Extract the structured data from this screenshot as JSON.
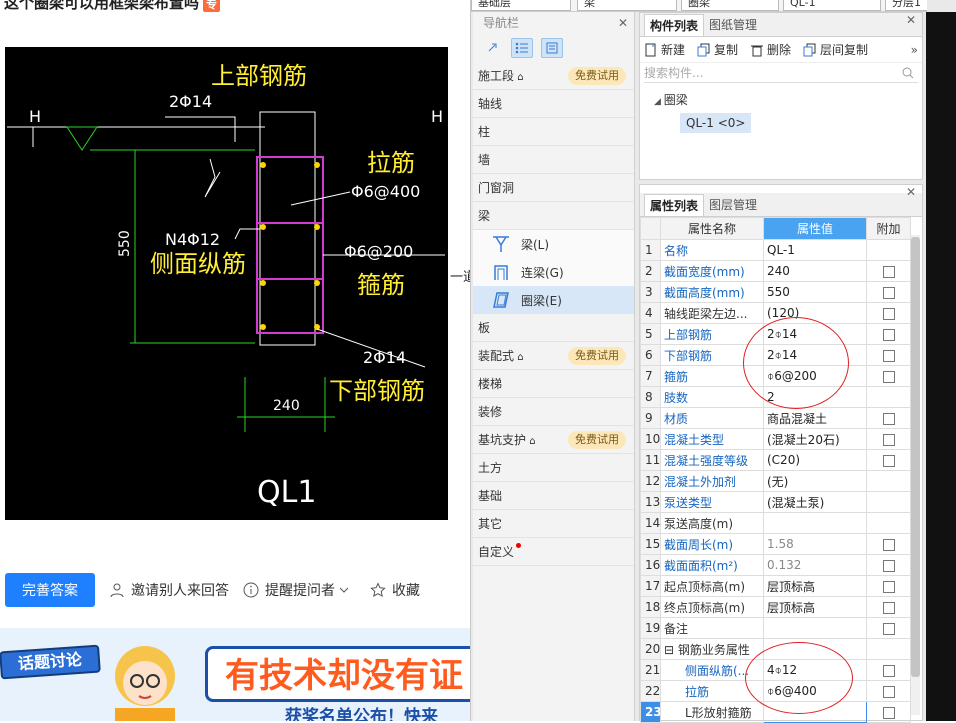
{
  "question": {
    "title": "这个圈梁可以用框架梁布置吗",
    "badge": "专"
  },
  "drawing": {
    "top_rebar_label": "上部钢筋",
    "top_rebar_spec": "2Φ14",
    "tie_label": "拉筋",
    "tie_spec": "Φ6@400",
    "stirrup_spec": "Φ6@200",
    "stirrup_label": "箍筋",
    "side_label": "侧面纵筋",
    "side_spec": "N4Φ12",
    "bottom_spec": "2Φ14",
    "bottom_label": "下部钢筋",
    "height_dim": "550",
    "width_dim": "240",
    "beam_name": "QL1",
    "elev_marker": "H",
    "edge_text": "一道"
  },
  "actions": {
    "answer": "完善答案",
    "invite": "邀请别人来回答",
    "remind": "提醒提问者",
    "favorite": "收藏"
  },
  "banner": {
    "tag": "话题讨论",
    "headline": "有技术却没有证",
    "sub": "获奖名单公布！快来"
  },
  "app": {
    "combos": [
      "基础层",
      "梁",
      "圈梁",
      "QL-1",
      "分层1"
    ],
    "nav": {
      "title": "导航栏",
      "items": [
        {
          "label": "施工段",
          "badge": "免费试用"
        },
        {
          "label": "轴线"
        },
        {
          "label": "柱"
        },
        {
          "label": "墙"
        },
        {
          "label": "门窗洞"
        },
        {
          "label": "梁"
        }
      ],
      "beam_children": [
        {
          "label": "梁(L)",
          "icon": "beam-icon"
        },
        {
          "label": "连梁(G)",
          "icon": "coupling-beam-icon"
        },
        {
          "label": "圈梁(E)",
          "icon": "ring-beam-icon"
        }
      ],
      "items_after": [
        {
          "label": "板"
        },
        {
          "label": "装配式",
          "badge": "免费试用"
        },
        {
          "label": "楼梯"
        },
        {
          "label": "装修"
        },
        {
          "label": "基坑支护",
          "badge": "免费试用"
        },
        {
          "label": "土方"
        },
        {
          "label": "基础"
        },
        {
          "label": "其它"
        },
        {
          "label": "自定义"
        }
      ]
    },
    "component_list": {
      "tabs": [
        "构件列表",
        "图纸管理"
      ],
      "toolbar": [
        "新建",
        "复制",
        "删除",
        "层间复制"
      ],
      "search_placeholder": "搜索构件...",
      "tree_parent": "圈梁",
      "tree_child": "QL-1 <0>"
    },
    "properties": {
      "tabs": [
        "属性列表",
        "图层管理"
      ],
      "headers": [
        "属性名称",
        "属性值",
        "附加"
      ],
      "rows": [
        {
          "n": "1",
          "name": "名称",
          "value": "QL-1",
          "chk": false,
          "blue": true
        },
        {
          "n": "2",
          "name": "截面宽度(mm)",
          "value": "240",
          "chk": true,
          "blue": true
        },
        {
          "n": "3",
          "name": "截面高度(mm)",
          "value": "550",
          "chk": true,
          "blue": true
        },
        {
          "n": "4",
          "name": "轴线距梁左边...",
          "value": "(120)",
          "chk": true,
          "blue": false
        },
        {
          "n": "5",
          "name": "上部钢筋",
          "value": "2⌽14",
          "chk": true,
          "blue": true
        },
        {
          "n": "6",
          "name": "下部钢筋",
          "value": "2⌽14",
          "chk": true,
          "blue": true
        },
        {
          "n": "7",
          "name": "箍筋",
          "value": "⌽6@200",
          "chk": true,
          "blue": true
        },
        {
          "n": "8",
          "name": "肢数",
          "value": "2",
          "chk": false,
          "blue": true
        },
        {
          "n": "9",
          "name": "材质",
          "value": "商品混凝土",
          "chk": true,
          "blue": true
        },
        {
          "n": "10",
          "name": "混凝土类型",
          "value": "(混凝土20石)",
          "chk": true,
          "blue": true
        },
        {
          "n": "11",
          "name": "混凝土强度等级",
          "value": "(C20)",
          "chk": true,
          "blue": true
        },
        {
          "n": "12",
          "name": "混凝土外加剂",
          "value": "(无)",
          "chk": false,
          "blue": true
        },
        {
          "n": "13",
          "name": "泵送类型",
          "value": "(混凝土泵)",
          "chk": false,
          "blue": true
        },
        {
          "n": "14",
          "name": "泵送高度(m)",
          "value": "",
          "chk": false,
          "blue": false
        },
        {
          "n": "15",
          "name": "截面周长(m)",
          "value": "1.58",
          "chk": true,
          "blue": true,
          "gray": true
        },
        {
          "n": "16",
          "name": "截面面积(m²)",
          "value": "0.132",
          "chk": true,
          "blue": true,
          "gray": true
        },
        {
          "n": "17",
          "name": "起点顶标高(m)",
          "value": "层顶标高",
          "chk": true,
          "blue": false
        },
        {
          "n": "18",
          "name": "终点顶标高(m)",
          "value": "层顶标高",
          "chk": true,
          "blue": false
        },
        {
          "n": "19",
          "name": "备注",
          "value": "",
          "chk": true,
          "blue": false
        },
        {
          "n": "20",
          "name": "⊟ 钢筋业务属性",
          "value": "",
          "chk": false,
          "blue": false
        },
        {
          "n": "21",
          "name": "侧面纵筋(...",
          "value": "4⌽12",
          "chk": true,
          "blue": true,
          "indent": true
        },
        {
          "n": "22",
          "name": "拉筋",
          "value": "⌽6@400",
          "chk": true,
          "blue": true,
          "indent": true
        },
        {
          "n": "23",
          "name": "L形放射箍筋",
          "value": "",
          "chk": true,
          "blue": false,
          "indent": true,
          "current": true
        }
      ]
    }
  }
}
